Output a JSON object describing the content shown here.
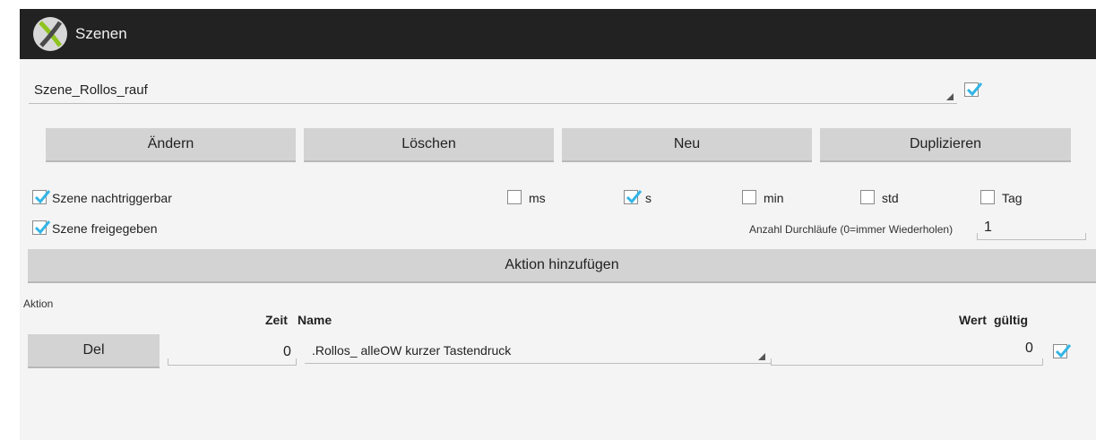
{
  "app": {
    "title": "Szenen"
  },
  "scene_select": {
    "value": "Szene_Rollos_rauf"
  },
  "toolbar": {
    "change_label": "Ändern",
    "delete_label": "Löschen",
    "new_label": "Neu",
    "duplicate_label": "Duplizieren"
  },
  "options": {
    "retriggerable_label": "Szene nachtriggerbar",
    "enabled_label": "Szene freigegeben",
    "scene_checkbox_checked": true,
    "retriggerable_checked": true,
    "enabled_checked": true,
    "units": [
      {
        "label": "ms",
        "checked": false
      },
      {
        "label": "s",
        "checked": true
      },
      {
        "label": "min",
        "checked": false
      },
      {
        "label": "std",
        "checked": false
      },
      {
        "label": "Tag",
        "checked": false
      }
    ],
    "runs_label": "Anzahl Durchläufe (0=immer Wiederholen)",
    "runs_value": "1"
  },
  "add_action_label": "Aktion hinzufügen",
  "actions": {
    "section_label": "Aktion",
    "headers": {
      "time": "Zeit",
      "name": "Name",
      "value": "Wert",
      "valid": "gültig"
    },
    "rows": [
      {
        "del_label": "Del",
        "time": "0",
        "name": ".Rollos_ alleOW kurzer Tastendruck",
        "value": "0",
        "valid": true
      }
    ]
  },
  "colors": {
    "accent": "#33b5e5",
    "actionbar": "#222222",
    "button": "#d3d3d3"
  },
  "icons": {
    "logo": "x-logo-icon",
    "check": "check-icon",
    "dropdown": "dropdown-corner-icon"
  }
}
